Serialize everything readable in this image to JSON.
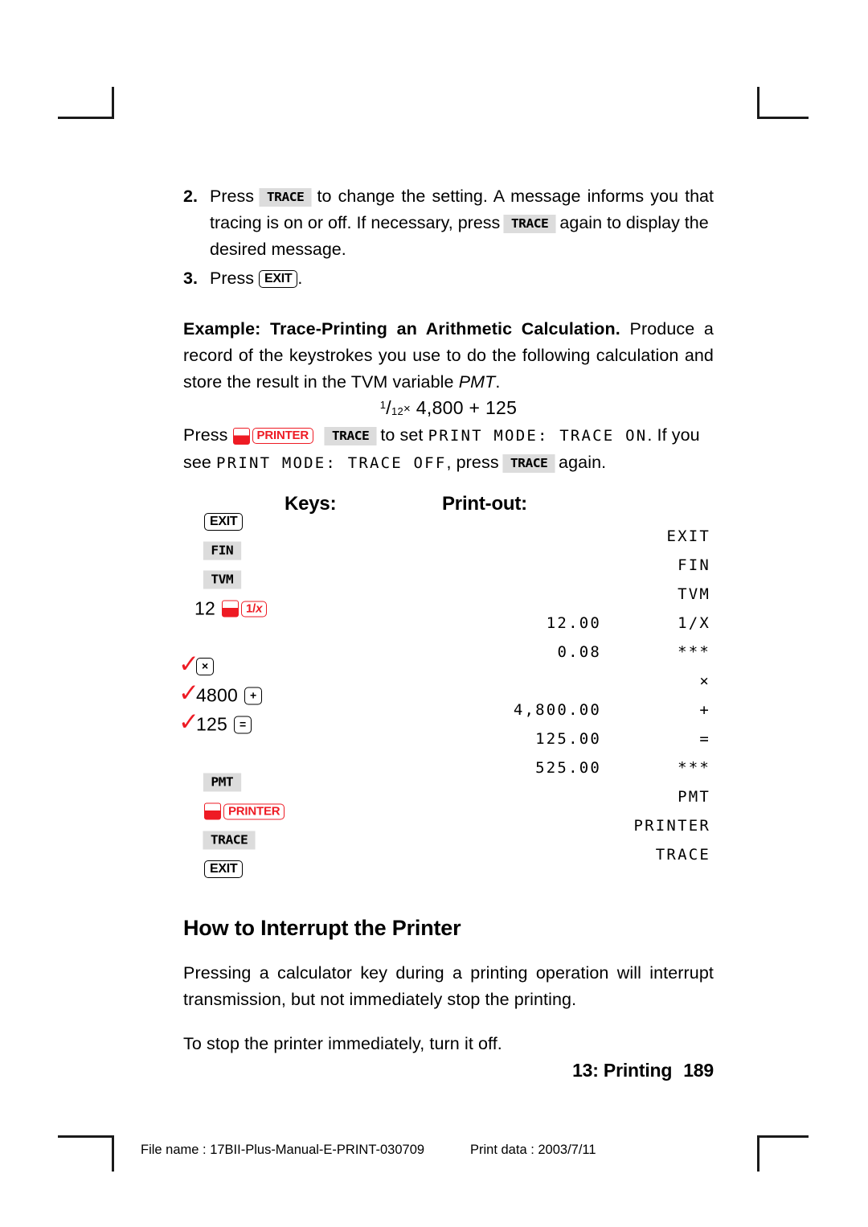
{
  "steps": [
    {
      "num": "2.",
      "seg1": "Press",
      "key1": "TRACE",
      "seg2": "to change the setting. A message informs you that tracing is on or off. If necessary, press",
      "key2": "TRACE",
      "seg3": "again to display the",
      "seg4": "desired message."
    },
    {
      "num": "3.",
      "seg1": "Press",
      "key1": "EXIT",
      "seg2": "."
    }
  ],
  "example": {
    "heading": "Example: Trace-Printing an Arithmetic Calculation.",
    "body": "Produce a record of the keystrokes you use to do the following calculation and store the result in the TVM variable",
    "variable": "PMT",
    "period": ".",
    "formula": {
      "numerator": "1",
      "slash": "/",
      "denominator": "12",
      "times": "×",
      "rest": "4,800 + 125"
    },
    "press_line": {
      "press": "Press",
      "shift_key": "shift-red",
      "key_printer": "PRINTER",
      "key_trace": "TRACE",
      "to_set": "to set",
      "display_on": "PRINT MODE: TRACE ON",
      "after": ". If you",
      "see": "see",
      "display_off": "PRINT MODE: TRACE OFF",
      "comma_press": ", press",
      "key_trace2": "TRACE",
      "again": "again."
    }
  },
  "table": {
    "header_keys": "Keys:",
    "header_print": "Print-out:",
    "rows": [
      {
        "check": "",
        "keys": [
          {
            "type": "key-out",
            "label": "EXIT"
          }
        ],
        "print_num": "",
        "print_cmd": "EXIT"
      },
      {
        "check": "",
        "keys": [
          {
            "type": "key-grey",
            "label": "FIN"
          }
        ],
        "print_num": "",
        "print_cmd": "FIN"
      },
      {
        "check": "",
        "keys": [
          {
            "type": "key-grey",
            "label": "TVM"
          }
        ],
        "print_num": "",
        "print_cmd": "TVM"
      },
      {
        "check": "",
        "keys": [
          {
            "type": "text",
            "label": "12"
          },
          {
            "type": "shift",
            "label": ""
          },
          {
            "type": "key-red-italic",
            "label": "1/x"
          }
        ],
        "print_num": "12.00",
        "print_cmd": "1/X"
      },
      {
        "check": "",
        "keys": [],
        "print_num": "0.08",
        "print_cmd": "***"
      },
      {
        "check": "✓",
        "keys": [
          {
            "type": "key-out-sym",
            "label": "×"
          }
        ],
        "print_num": "",
        "print_cmd": "×"
      },
      {
        "check": "✓",
        "keys": [
          {
            "type": "text",
            "label": "4800"
          },
          {
            "type": "key-out-sym",
            "label": "+"
          }
        ],
        "print_num": "4,800.00",
        "print_cmd": "+"
      },
      {
        "check": "✓",
        "keys": [
          {
            "type": "text",
            "label": "125"
          },
          {
            "type": "key-out-sym",
            "label": "="
          }
        ],
        "print_num": "125.00",
        "print_cmd": "="
      },
      {
        "check": "",
        "keys": [],
        "print_num": "525.00",
        "print_cmd": "***"
      },
      {
        "check": "",
        "keys": [
          {
            "type": "key-grey",
            "label": "PMT"
          }
        ],
        "print_num": "",
        "print_cmd": "PMT"
      },
      {
        "check": "",
        "keys": [
          {
            "type": "shift",
            "label": ""
          },
          {
            "type": "key-red",
            "label": "PRINTER"
          }
        ],
        "print_num": "",
        "print_cmd": "PRINTER"
      },
      {
        "check": "",
        "keys": [
          {
            "type": "key-grey",
            "label": "TRACE"
          }
        ],
        "print_num": "",
        "print_cmd": "TRACE"
      },
      {
        "check": "",
        "keys": [
          {
            "type": "key-out",
            "label": "EXIT"
          }
        ],
        "print_num": "",
        "print_cmd": ""
      }
    ]
  },
  "section": {
    "heading": "How to Interrupt the Printer",
    "para1": "Pressing a calculator key during a printing operation will interrupt transmission, but not immediately stop the printing.",
    "para2": "To stop the printer immediately, turn it off."
  },
  "footer": {
    "chapter": "13: Printing",
    "page": "189",
    "file_name": "File name : 17BII-Plus-Manual-E-PRINT-030709",
    "print_data": "Print data : 2003/7/11"
  },
  "colors": {
    "red": "#ee1b24",
    "key_grey": "#dcdcdc",
    "ink": "#000000"
  }
}
